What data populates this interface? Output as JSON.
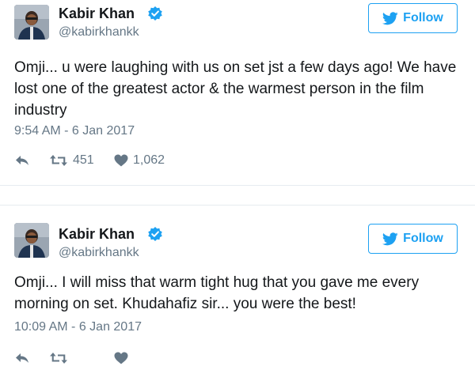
{
  "colors": {
    "brand_blue": "#1da1f2",
    "secondary_text": "#657786",
    "primary_text": "#14171a",
    "divider": "#e6ecf0"
  },
  "tweets": [
    {
      "display_name": "Kabir Khan",
      "handle": "@kabirkhankk",
      "verified": true,
      "follow_label": "Follow",
      "text": "Omji... u were laughing with us on set jst a few days ago! We have lost one of the greatest actor & the warmest person in the film industry",
      "timestamp": "9:54 AM - 6 Jan 2017",
      "retweets": "451",
      "likes": "1,062",
      "icons": [
        "avatar",
        "verified-badge-icon",
        "twitter-bird-icon",
        "reply-icon",
        "retweet-icon",
        "heart-icon"
      ]
    },
    {
      "display_name": "Kabir Khan",
      "handle": "@kabirkhankk",
      "verified": true,
      "follow_label": "Follow",
      "text": "Omji... I will miss that warm tight hug that you gave me every morning on set. Khudahafiz sir... you were the best!",
      "timestamp": "10:09 AM - 6 Jan 2017",
      "retweets": "",
      "likes": "",
      "icons": [
        "avatar",
        "verified-badge-icon",
        "twitter-bird-icon",
        "reply-icon",
        "retweet-icon",
        "heart-icon"
      ]
    }
  ]
}
